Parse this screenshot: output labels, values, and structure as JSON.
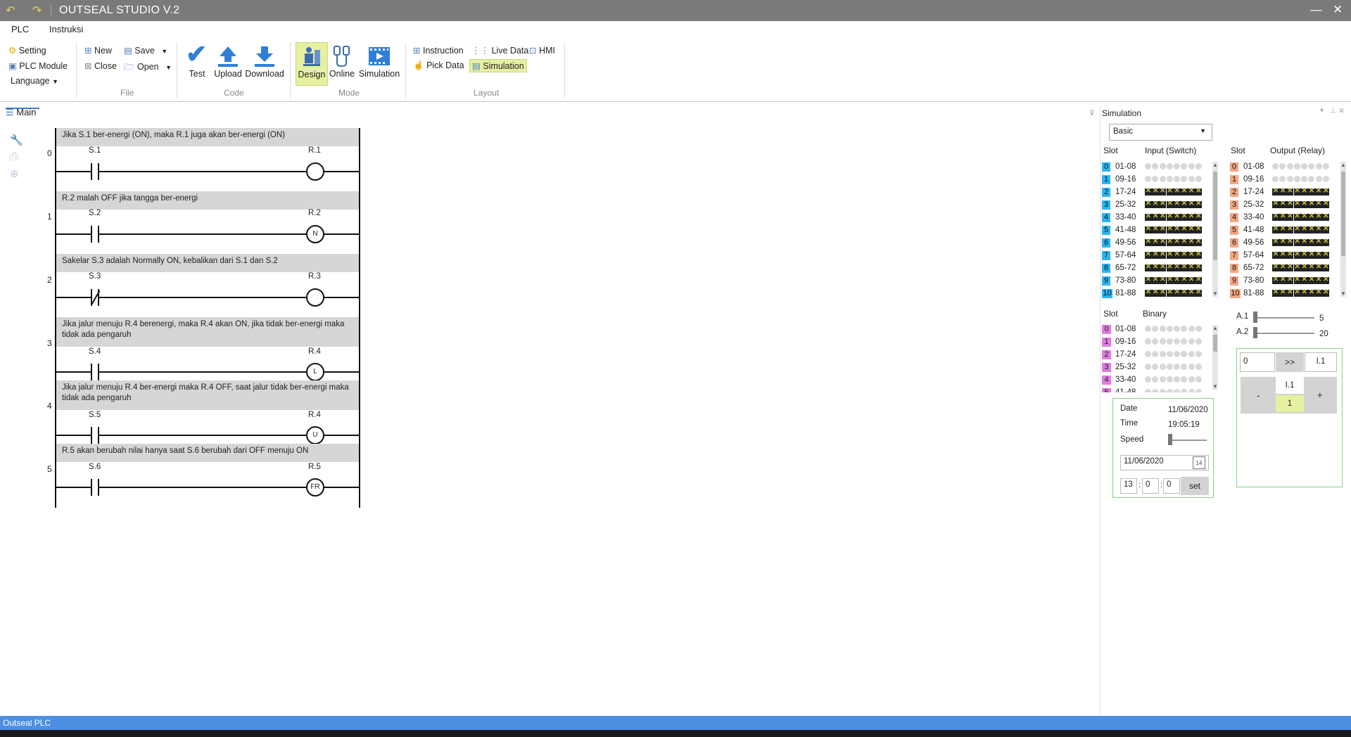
{
  "window": {
    "title": "OUTSEAL STUDIO V.2"
  },
  "menu": {
    "tabs": [
      "PLC",
      "Instruksi"
    ]
  },
  "ribbon": {
    "plc": {
      "setting": "Setting",
      "plc_module": "PLC Module",
      "language": "Language"
    },
    "file": {
      "new": "New",
      "save": "Save",
      "close": "Close",
      "open": "Open",
      "group": "File"
    },
    "code": {
      "test": "Test",
      "upload": "Upload",
      "download": "Download",
      "group": "Code"
    },
    "mode": {
      "design": "Design",
      "online": "Online",
      "simulation": "Simulation",
      "group": "Mode"
    },
    "layout": {
      "instruction": "Instruction",
      "live_data": "Live Data",
      "hmi": "HMI",
      "pick_data": "Pick Data",
      "simulation": "Simulation",
      "group": "Layout"
    }
  },
  "document": {
    "tab": "Main"
  },
  "rungs": [
    {
      "num": "0",
      "comment": "Jika S.1 ber-energi (ON), maka R.1 juga akan ber-energi (ON)",
      "contact": "S.1",
      "coil": "R.1",
      "contact_type": "NO",
      "coil_mark": ""
    },
    {
      "num": "1",
      "comment": "R.2 malah OFF jika tangga ber-energi",
      "contact": "S.2",
      "coil": "R.2",
      "contact_type": "NO",
      "coil_mark": "N"
    },
    {
      "num": "2",
      "comment": "Sakelar S.3 adalah Normally ON, kebalikan dari S.1 dan S.2",
      "contact": "S.3",
      "coil": "R.3",
      "contact_type": "NC",
      "coil_mark": ""
    },
    {
      "num": "3",
      "comment": "Jika jalur menuju R.4 berenergi, maka R.4 akan ON, jika tidak ber-energi maka tidak ada pengaruh",
      "contact": "S.4",
      "coil": "R.4",
      "contact_type": "NO",
      "coil_mark": "L"
    },
    {
      "num": "4",
      "comment": "Jika jalur menuju R.4 ber-energi maka R.4 OFF, saat jalur tidak ber-energi maka tidak ada pengaruh",
      "contact": "S.5",
      "coil": "R.4",
      "contact_type": "NO",
      "coil_mark": "U"
    },
    {
      "num": "5",
      "comment": "R.5 akan berubah nilai hanya saat S.6 berubah dari OFF menuju ON",
      "contact": "S.6",
      "coil": "R.5",
      "contact_type": "NO",
      "coil_mark": "FR"
    }
  ],
  "simulation": {
    "title": "Simulation",
    "mode": "Basic",
    "input_header": {
      "slot": "Slot",
      "label": "Input (Switch)"
    },
    "output_header": {
      "slot": "Slot",
      "label": "Output (Relay)"
    },
    "io_rows": [
      {
        "slot": "0",
        "range": "01-08",
        "state": "off"
      },
      {
        "slot": "1",
        "range": "09-16",
        "state": "off"
      },
      {
        "slot": "2",
        "range": "17-24",
        "state": "x"
      },
      {
        "slot": "3",
        "range": "25-32",
        "state": "x"
      },
      {
        "slot": "4",
        "range": "33-40",
        "state": "x"
      },
      {
        "slot": "5",
        "range": "41-48",
        "state": "x"
      },
      {
        "slot": "6",
        "range": "49-56",
        "state": "x"
      },
      {
        "slot": "7",
        "range": "57-64",
        "state": "x"
      },
      {
        "slot": "8",
        "range": "65-72",
        "state": "x"
      },
      {
        "slot": "9",
        "range": "73-80",
        "state": "x"
      },
      {
        "slot": "10",
        "range": "81-88",
        "state": "x"
      }
    ],
    "binary_header": {
      "slot": "Slot",
      "label": "Binary"
    },
    "binary_rows": [
      {
        "slot": "0",
        "range": "01-08"
      },
      {
        "slot": "1",
        "range": "09-16"
      },
      {
        "slot": "2",
        "range": "17-24"
      },
      {
        "slot": "3",
        "range": "25-32"
      },
      {
        "slot": "4",
        "range": "33-40"
      },
      {
        "slot": "5",
        "range": "41-48"
      }
    ],
    "analog": [
      {
        "label": "A.1",
        "value": "5"
      },
      {
        "label": "A.2",
        "value": "20"
      }
    ],
    "datetime": {
      "date_label": "Date",
      "date_value": "11/06/2020",
      "time_label": "Time",
      "time_value": "19:05:19",
      "speed_label": "Speed",
      "date_input": "11/06/2020",
      "calendar_day": "14",
      "hour": "13",
      "minute": "0",
      "second": "0",
      "set_label": "set"
    },
    "int_panel": {
      "input_value": "0",
      "arrow": ">>",
      "target": "I.1",
      "minus": "-",
      "plus": "+",
      "var_label": "I.1",
      "var_value": "1"
    },
    "colors": {
      "input_slot": "#29b6f6",
      "output_slot": "#f4a582",
      "binary_slot": "#e07be0",
      "highlight": "#e6f0a0"
    }
  },
  "status": {
    "text": "Outseal PLC"
  }
}
